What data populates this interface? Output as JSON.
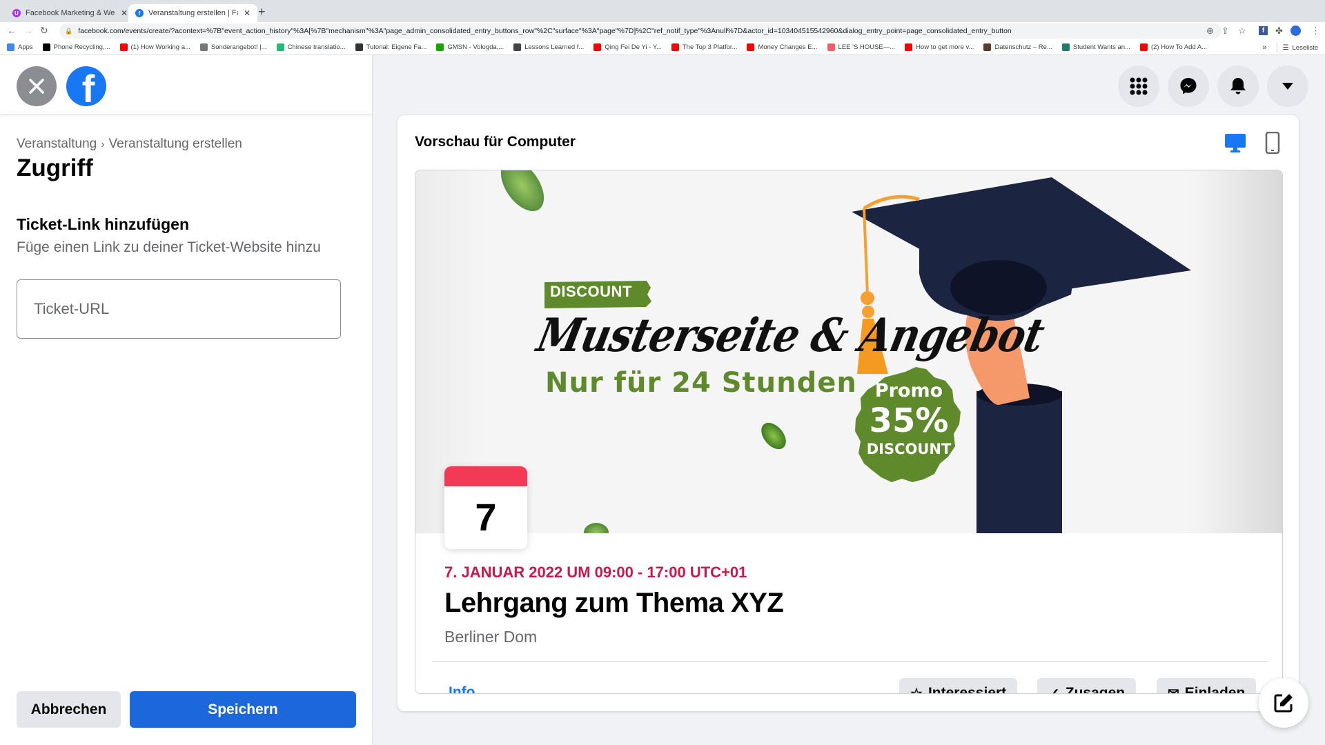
{
  "browser": {
    "tabs": [
      {
        "title": "Facebook Marketing & Werbea",
        "icon": "udemy-icon",
        "active": false
      },
      {
        "title": "Veranstaltung erstellen | Faceb",
        "icon": "facebook-icon",
        "active": true
      }
    ],
    "new_tab_label": "+",
    "url": "facebook.com/events/create/?acontext=%7B\"event_action_history\"%3A[%7B\"mechanism\"%3A\"page_admin_consolidated_entry_buttons_row\"%2C\"surface\"%3A\"page\"%7D]%2C\"ref_notif_type\"%3Anull%7D&actor_id=103404515542960&dialog_entry_point=page_consolidated_entry_button",
    "bookmarks": [
      {
        "label": "Apps",
        "icon": "apps-grid-icon",
        "color": "#4285f4"
      },
      {
        "label": "Phone Recycling,...",
        "icon": "o2-icon",
        "color": "#000000"
      },
      {
        "label": "(1) How Working a...",
        "icon": "youtube-icon",
        "color": "#ff0000"
      },
      {
        "label": "Sonderangebot! |...",
        "icon": "check-badge-icon",
        "color": "#777777"
      },
      {
        "label": "Chinese translatio...",
        "icon": "fiverr-icon",
        "color": "#1dbf73"
      },
      {
        "label": "Tutorial: Eigene Fa...",
        "icon": "hash-icon",
        "color": "#333333"
      },
      {
        "label": "GMSN - Vologda,...",
        "icon": "upwork-icon",
        "color": "#14a800"
      },
      {
        "label": "Lessons Learned f...",
        "icon": "percent-icon",
        "color": "#444444"
      },
      {
        "label": "Qing Fei De Yi - Y...",
        "icon": "youtube-icon",
        "color": "#ff0000"
      },
      {
        "label": "The Top 3 Platfor...",
        "icon": "youtube-icon",
        "color": "#ff0000"
      },
      {
        "label": "Money Changes E...",
        "icon": "youtube-icon",
        "color": "#ff0000"
      },
      {
        "label": "LEE 'S HOUSE—...",
        "icon": "airbnb-icon",
        "color": "#ff5a5f"
      },
      {
        "label": "How to get more v...",
        "icon": "youtube-icon",
        "color": "#ff0000"
      },
      {
        "label": "Datenschutz – Re...",
        "icon": "image-thumb-icon",
        "color": "#5a3a2a"
      },
      {
        "label": "Student Wants an...",
        "icon": "t-circle-icon",
        "color": "#1b7f6b"
      },
      {
        "label": "(2) How To Add A...",
        "icon": "youtube-icon",
        "color": "#ff0000"
      }
    ],
    "overflow_label": "»",
    "reading_list_label": "Leseliste"
  },
  "left_panel": {
    "breadcrumb": [
      "Veranstaltung",
      "Veranstaltung erstellen"
    ],
    "breadcrumb_sep": "›",
    "title": "Zugriff",
    "section_title": "Ticket-Link hinzufügen",
    "section_subtitle": "Füge einen Link zu deiner Ticket-Website hinzu",
    "ticket_url": {
      "value": "",
      "placeholder": "Ticket-URL"
    },
    "cancel_label": "Abbrechen",
    "save_label": "Speichern"
  },
  "preview": {
    "title": "Vorschau für Computer",
    "active_device": "desktop",
    "cover": {
      "badge": "DISCOUNT",
      "headline": "Musterseite & Angebot",
      "subline": "Nur für 24 Stunden",
      "promo_line1": "Promo",
      "promo_value": "35%",
      "promo_line3": "DISCOUNT"
    },
    "event": {
      "day": "7",
      "date_line": "7. JANUAR 2022 UM 09:00 - 17:00 UTC+01",
      "title": "Lehrgang zum Thema XYZ",
      "location": "Berliner Dom",
      "tab_info": "Info",
      "buttons": [
        {
          "label": "Interessiert",
          "icon": "star-outline-icon"
        },
        {
          "label": "Zusagen",
          "icon": "check-circle-icon"
        },
        {
          "label": "Einladen",
          "icon": "envelope-icon"
        }
      ]
    }
  },
  "colors": {
    "fb_blue": "#1877f2",
    "save_button": "#1b67db",
    "date_red": "#c9184a",
    "calendar_red": "#f23a56",
    "promo_green": "#5e8a2b"
  }
}
